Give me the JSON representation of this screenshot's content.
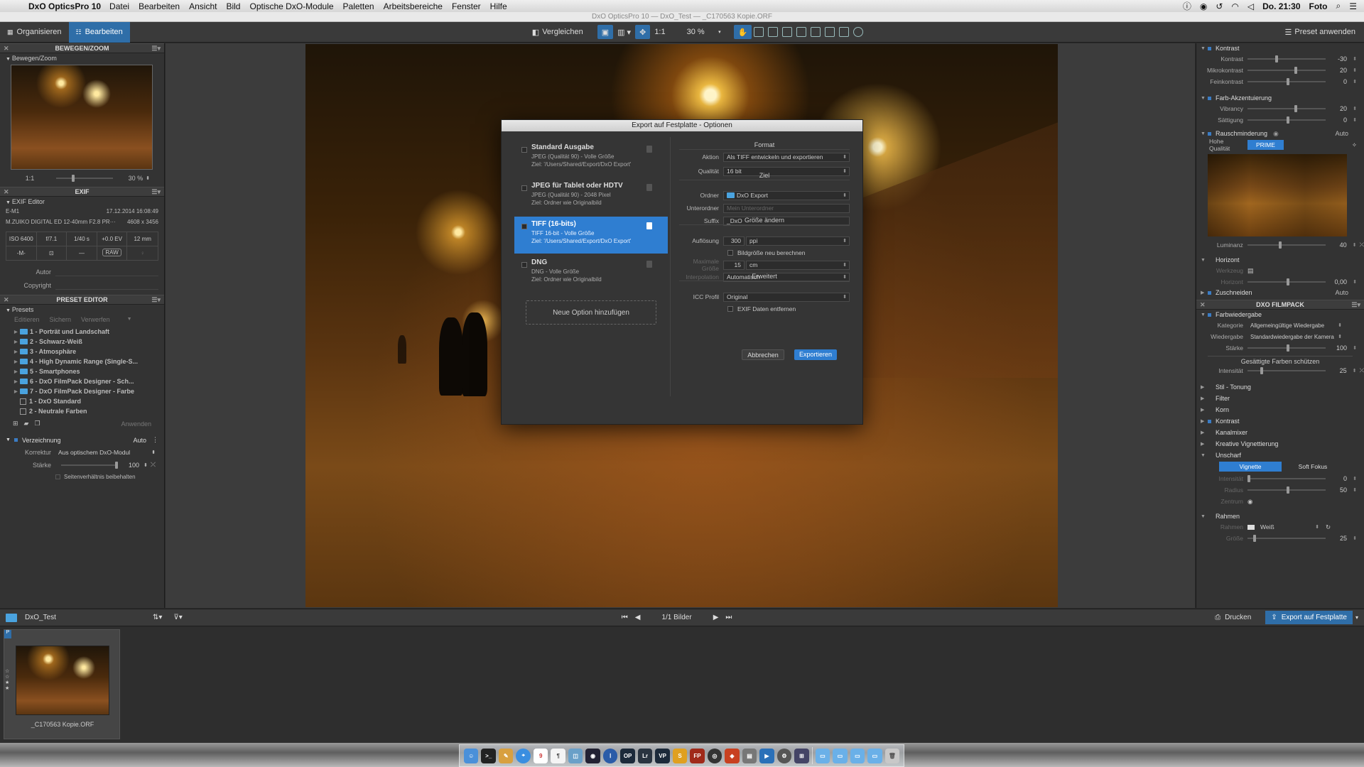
{
  "menubar": {
    "app": "DxO OpticsPro 10",
    "items": [
      "Datei",
      "Bearbeiten",
      "Ansicht",
      "Bild",
      "Optische DxO-Module",
      "Paletten",
      "Arbeitsbereiche",
      "Fenster",
      "Hilfe"
    ],
    "clock": "Do. 21:30",
    "user": "Foto"
  },
  "window": {
    "title": "DxO OpticsPro 10 — DxO_Test — _C170563 Kopie.ORF"
  },
  "toolbar": {
    "tab_organize": "Organisieren",
    "tab_edit": "Bearbeiten",
    "compare": "Vergleichen",
    "one_to_one": "1:1",
    "zoom": "30 %",
    "preset_apply": "Preset anwenden"
  },
  "left": {
    "move_zoom": {
      "title": "BEWEGEN/ZOOM",
      "subtitle": "Bewegen/Zoom",
      "ratio": "1:1",
      "zoom": "30 %"
    },
    "exif": {
      "title": "EXIF",
      "subtitle": "EXIF Editor",
      "camera": "E-M1",
      "date": "17.12.2014 16:08:49",
      "lens": "M.ZUIKO DIGITAL ED 12-40mm F2.8 PR···",
      "size": "4608 x 3456",
      "iso": "ISO 6400",
      "aperture": "f/7.1",
      "shutter": "1/40 s",
      "ev": "+0.0 EV",
      "focal": "12 mm",
      "mode": "-M-",
      "dash": "—",
      "raw": "RAW",
      "author_label": "Autor",
      "copyright_label": "Copyright"
    },
    "preset_editor": {
      "title": "PRESET EDITOR",
      "section": "Presets",
      "edit": "Editieren",
      "save": "Sichern",
      "discard": "Verwerfen",
      "apply": "Anwenden",
      "items": [
        "1 - Porträt und Landschaft",
        "2 - Schwarz-Weiß",
        "3 - Atmosphäre",
        "4 - High Dynamic Range (Single-S...",
        "5 - Smartphones",
        "6 - DxO FilmPack Designer - Sch...",
        "7 - DxO FilmPack Designer - Farbe",
        "1 - DxO Standard",
        "2 - Neutrale Farben"
      ]
    },
    "distortion": {
      "title": "Verzeichnung",
      "auto": "Auto",
      "korrektur_label": "Korrektur",
      "korrektur_value": "Aus optischem DxO-Modul",
      "staerke_label": "Stärke",
      "staerke_value": "100",
      "keep_ratio": "Seitenverhältnis beibehalten"
    }
  },
  "dialog": {
    "title": "Export auf Festplatte - Optionen",
    "options": [
      {
        "name": "Standard Ausgabe",
        "line1": "JPEG (Qualität 90) - Volle Größe",
        "line2": "Ziel: '/Users/Shared/Export/DxO Export'"
      },
      {
        "name": "JPEG für Tablet oder HDTV",
        "line1": "JPEG (Qualität 90) - 2048 Pixel",
        "line2": "Ziel: Ordner wie Originalbild"
      },
      {
        "name": "TIFF (16-bits)",
        "line1": "TIFF 16-bit - Volle Größe",
        "line2": "Ziel: '/Users/Shared/Export/DxO Export'"
      },
      {
        "name": "DNG",
        "line1": "DNG - Volle Größe",
        "line2": "Ziel: Ordner wie Originalbild"
      }
    ],
    "add_option": "Neue Option hinzufügen",
    "format_section": "Format",
    "action_label": "Aktion",
    "action_value": "Als TIFF entwickeln und exportieren",
    "quality_label": "Qualität",
    "quality_value": "16 bit",
    "target_section": "Ziel",
    "folder_label": "Ordner",
    "folder_value": "DxO Export",
    "subfolder_label": "Unterordner",
    "subfolder_placeholder": "Mein Unterordner",
    "suffix_label": "Suffix",
    "suffix_value": "_DxO",
    "resize_section": "Größe ändern",
    "resolution_label": "Auflösung",
    "resolution_value": "300",
    "resolution_unit": "ppi",
    "recalc_label": "Bildgröße neu berechnen",
    "maxsize_label": "Maximale Größe",
    "maxsize_value": "15",
    "maxsize_unit": "cm",
    "interp_label": "Interpolation",
    "interp_value": "Automatisch",
    "advanced_section": "Erweitert",
    "icc_label": "ICC Profil",
    "icc_value": "Original",
    "exif_remove": "EXIF Daten entfernen",
    "cancel": "Abbrechen",
    "export": "Exportieren"
  },
  "right": {
    "contrast": {
      "title": "Kontrast",
      "kontrast": "Kontrast",
      "kontrast_v": "-30",
      "mikro": "Mikrokontrast",
      "mikro_v": "20",
      "fein": "Feinkontrast",
      "fein_v": "0"
    },
    "color_accent": {
      "title": "Farb-Akzentuierung",
      "vibrancy": "Vibrancy",
      "vibrancy_v": "20",
      "saett": "Sättigung",
      "saett_v": "0"
    },
    "noise": {
      "title": "Rauschminderung",
      "auto": "Auto",
      "hq": "Hohe Qualität",
      "prime": "PRIME",
      "lum": "Luminanz",
      "lum_v": "40"
    },
    "horizon": {
      "title": "Horizont",
      "tool": "Werkzeug",
      "hz": "Horizont",
      "hz_v": "0,00"
    },
    "crop": {
      "title": "Zuschneiden",
      "auto": "Auto"
    },
    "filmpack": {
      "title": "DXO FILMPACK",
      "farb": "Farbwiedergabe",
      "kat": "Kategorie",
      "kat_v": "Allgemeingültige Wiedergabe",
      "wg": "Wiedergabe",
      "wg_v": "Standardwiedergabe der Kamera",
      "st": "Stärke",
      "st_v": "100",
      "protect": "Gesättigte Farben schützen",
      "int": "Intensität",
      "int_v": "25"
    },
    "collapsed": [
      "Stil - Tonung",
      "Filter",
      "Korn",
      "Kontrast",
      "Kanalmixer",
      "Kreative Vignettierung"
    ],
    "unscharf": {
      "title": "Unscharf",
      "vignette": "Vignette",
      "soft": "Soft Fokus",
      "int": "Intensität",
      "int_v": "0",
      "radius": "Radius",
      "radius_v": "50",
      "zentrum": "Zentrum"
    },
    "rahmen": {
      "title": "Rahmen",
      "rahmen": "Rahmen",
      "rahmen_v": "Weiß",
      "groesse": "Größe",
      "groesse_v": "25"
    }
  },
  "bottom": {
    "folder": "DxO_Test",
    "count": "1/1 Bilder",
    "print": "Drucken",
    "export": "Export auf Festplatte"
  },
  "filmstrip": {
    "filename": "_C170563 Kopie.ORF"
  }
}
